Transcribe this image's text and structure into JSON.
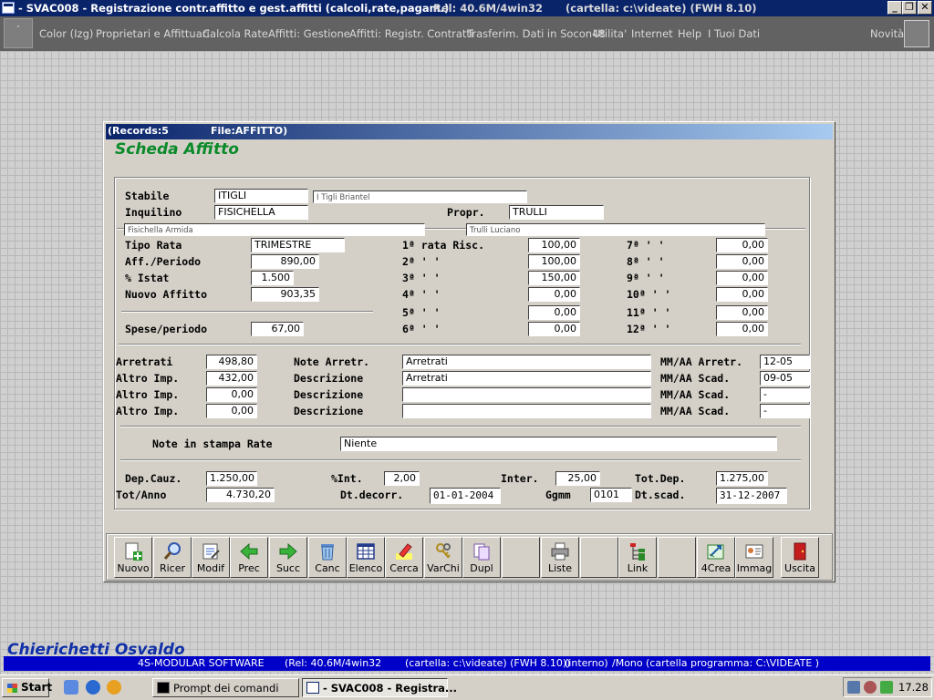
{
  "window": {
    "title": "- SVAC008 - Registrazione contr.affitto e gest.affitti (calcoli,rate,pagam.)",
    "rel": "Rel: 40.6M/4win32",
    "folder": "(cartella: c:\\videate) (FWH 8.10)"
  },
  "menu": {
    "items": [
      "Color (Izg)",
      "Proprietari e Affittuari",
      "Calcola Rate",
      "Affitti: Gestione",
      "Affitti: Registr. Contratti",
      "Trasferim. Dati in Socon48",
      "Utilita'",
      "Internet",
      "Help",
      "I Tuoi Dati"
    ],
    "right": "Novità"
  },
  "dialog": {
    "records": "(Records:5",
    "file": "File:AFFITTO)",
    "heading": "Scheda Affitto"
  },
  "form": {
    "stabile": {
      "label": "Stabile",
      "code": "ITIGLI",
      "desc": "I Tigli Briantel"
    },
    "inquilino": {
      "label": "Inquilino",
      "code": "FISICHELLA",
      "desc": "Fisichella Armida"
    },
    "propr": {
      "label": "Propr.",
      "code": "TRULLI",
      "desc": "Trulli Luciano"
    },
    "tipo_rata": {
      "label": "Tipo Rata",
      "value": "TRIMESTRE"
    },
    "aff_periodo": {
      "label": "Aff./Periodo",
      "value": "890,00"
    },
    "istat": {
      "label": "% Istat",
      "value": "1.500"
    },
    "nuovo_affitto": {
      "label": "Nuovo Affitto",
      "value": "903,35"
    },
    "spese_periodo": {
      "label": "Spese/periodo",
      "value": "67,00"
    },
    "rate_left": [
      {
        "label": "1ª rata Risc.",
        "value": "100,00"
      },
      {
        "label": "2ª  '     '",
        "value": "100,00"
      },
      {
        "label": "3ª  '     '",
        "value": "150,00"
      },
      {
        "label": "4ª  '     '",
        "value": "0,00"
      },
      {
        "label": "5ª  '     '",
        "value": "0,00"
      },
      {
        "label": "6ª  '     '",
        "value": "0,00"
      }
    ],
    "rate_right": [
      {
        "label": "7ª  '    '",
        "value": "0,00"
      },
      {
        "label": "8ª  '    '",
        "value": "0,00"
      },
      {
        "label": "9ª  '    '",
        "value": "0,00"
      },
      {
        "label": "10ª '    '",
        "value": "0,00"
      },
      {
        "label": "11ª '    '",
        "value": "0,00"
      },
      {
        "label": "12ª '    '",
        "value": "0,00"
      }
    ],
    "imports": [
      {
        "label": "Arretrati",
        "value": "498,80",
        "desc_label": "Note Arretr.",
        "desc": "Arretrati",
        "date_label": "MM/AA Arretr.",
        "date": "12-05"
      },
      {
        "label": "Altro Imp.",
        "value": "432,00",
        "desc_label": "Descrizione",
        "desc": "Arretrati",
        "date_label": "MM/AA Scad.",
        "date": "09-05"
      },
      {
        "label": "Altro Imp.",
        "value": "0,00",
        "desc_label": "Descrizione",
        "desc": "",
        "date_label": "MM/AA Scad.",
        "date": "-"
      },
      {
        "label": "Altro Imp.",
        "value": "0,00",
        "desc_label": "Descrizione",
        "desc": "",
        "date_label": "MM/AA Scad.",
        "date": "-"
      }
    ],
    "note_stampa": {
      "label": "Note in stampa Rate",
      "value": "Niente"
    },
    "dep_cauz": {
      "label": "Dep.Cauz.",
      "value": "1.250,00"
    },
    "int_pct": {
      "label": "%Int.",
      "value": "2,00"
    },
    "inter": {
      "label": "Inter.",
      "value": "25,00"
    },
    "tot_dep": {
      "label": "Tot.Dep.",
      "value": "1.275,00"
    },
    "tot_anno": {
      "label": "Tot/Anno",
      "value": "4.730,20"
    },
    "dt_decorr": {
      "label": "Dt.decorr.",
      "value": "01-01-2004"
    },
    "ggmm": {
      "label": "Ggmm",
      "value": "0101"
    },
    "dt_scad": {
      "label": "Dt.scad.",
      "value": "31-12-2007"
    }
  },
  "toolbar": {
    "buttons": [
      {
        "label": "Nuovo",
        "icon": "new-icon"
      },
      {
        "label": "Ricer",
        "icon": "magnifier-icon"
      },
      {
        "label": "Modif",
        "icon": "edit-icon"
      },
      {
        "label": "Prec",
        "icon": "arrow-left-icon"
      },
      {
        "label": "Succ",
        "icon": "arrow-right-icon"
      },
      {
        "label": "Canc",
        "icon": "trash-icon"
      },
      {
        "label": "Elenco",
        "icon": "grid-icon"
      },
      {
        "label": "Cerca",
        "icon": "highlighter-icon"
      },
      {
        "label": "VarChi",
        "icon": "keys-icon"
      },
      {
        "label": "Dupl",
        "icon": "duplicate-icon"
      },
      {
        "label": "",
        "icon": ""
      },
      {
        "label": "Liste",
        "icon": "printer-icon"
      },
      {
        "label": "",
        "icon": ""
      },
      {
        "label": "Link",
        "icon": "tree-icon"
      },
      {
        "label": "",
        "icon": ""
      },
      {
        "label": "4Crea",
        "icon": "create-icon"
      },
      {
        "label": "Immag",
        "icon": "image-card-icon"
      },
      {
        "label": "Uscita",
        "icon": "exit-door-icon"
      }
    ]
  },
  "footer": {
    "owner": "Chierichetti Osvaldo",
    "status": [
      "4S-MODULAR SOFTWARE",
      "(Rel: 40.6M/4win32",
      "(cartella: c:\\videate) (FWH 8.10))",
      "(interno)",
      "/Mono",
      "(cartella programma: C:\\VIDEATE )"
    ]
  },
  "taskbar": {
    "start": "Start",
    "tasks": [
      "Prompt dei comandi",
      "- SVAC008 - Registra..."
    ],
    "clock": "17.28"
  },
  "colors": {
    "title_bar": "#0a246a",
    "heading_green": "#0a8a2a",
    "status_blue": "#0000c8",
    "owner_blue": "#1030a8"
  }
}
